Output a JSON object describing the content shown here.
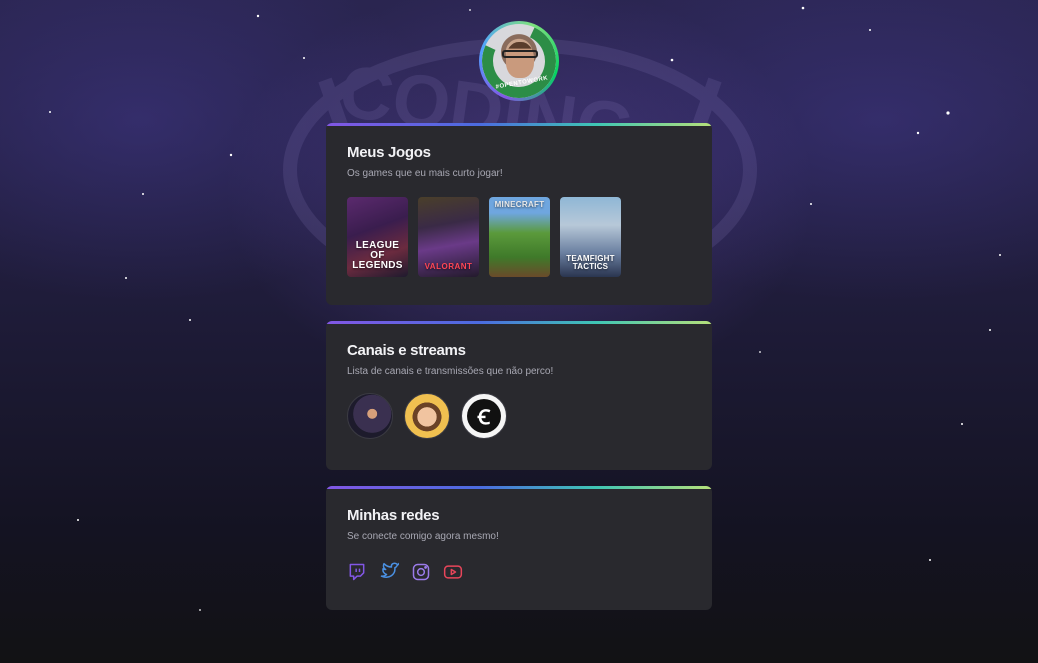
{
  "profile": {
    "avatar_badge": "#OPENTOWORK"
  },
  "games_card": {
    "title": "Meus Jogos",
    "subtitle": "Os games que eu mais curto jogar!",
    "games": [
      {
        "name": "LEAGUE OF LEGENDS",
        "icon": "league-of-legends-cover"
      },
      {
        "name": "VALORANT",
        "icon": "valorant-cover"
      },
      {
        "name": "MINECRAFT",
        "icon": "minecraft-cover"
      },
      {
        "name": "TEAMFIGHT TACTICS",
        "icon": "teamfight-tactics-cover"
      }
    ]
  },
  "channels_card": {
    "title": "Canais e streams",
    "subtitle": "Lista de canais e transmissões que não perco!",
    "channels": [
      {
        "icon": "streamer-avatar-1"
      },
      {
        "icon": "streamer-avatar-2"
      },
      {
        "icon": "streamer-avatar-3"
      }
    ]
  },
  "social_card": {
    "title": "Minhas redes",
    "subtitle": "Se conecte comigo agora mesmo!",
    "links": [
      {
        "icon": "twitch-icon",
        "color": "#8257e5"
      },
      {
        "icon": "twitter-icon",
        "color": "#4a90e2"
      },
      {
        "icon": "instagram-icon",
        "color": "#9b7bea"
      },
      {
        "icon": "youtube-icon",
        "color": "#e8455a"
      }
    ]
  }
}
